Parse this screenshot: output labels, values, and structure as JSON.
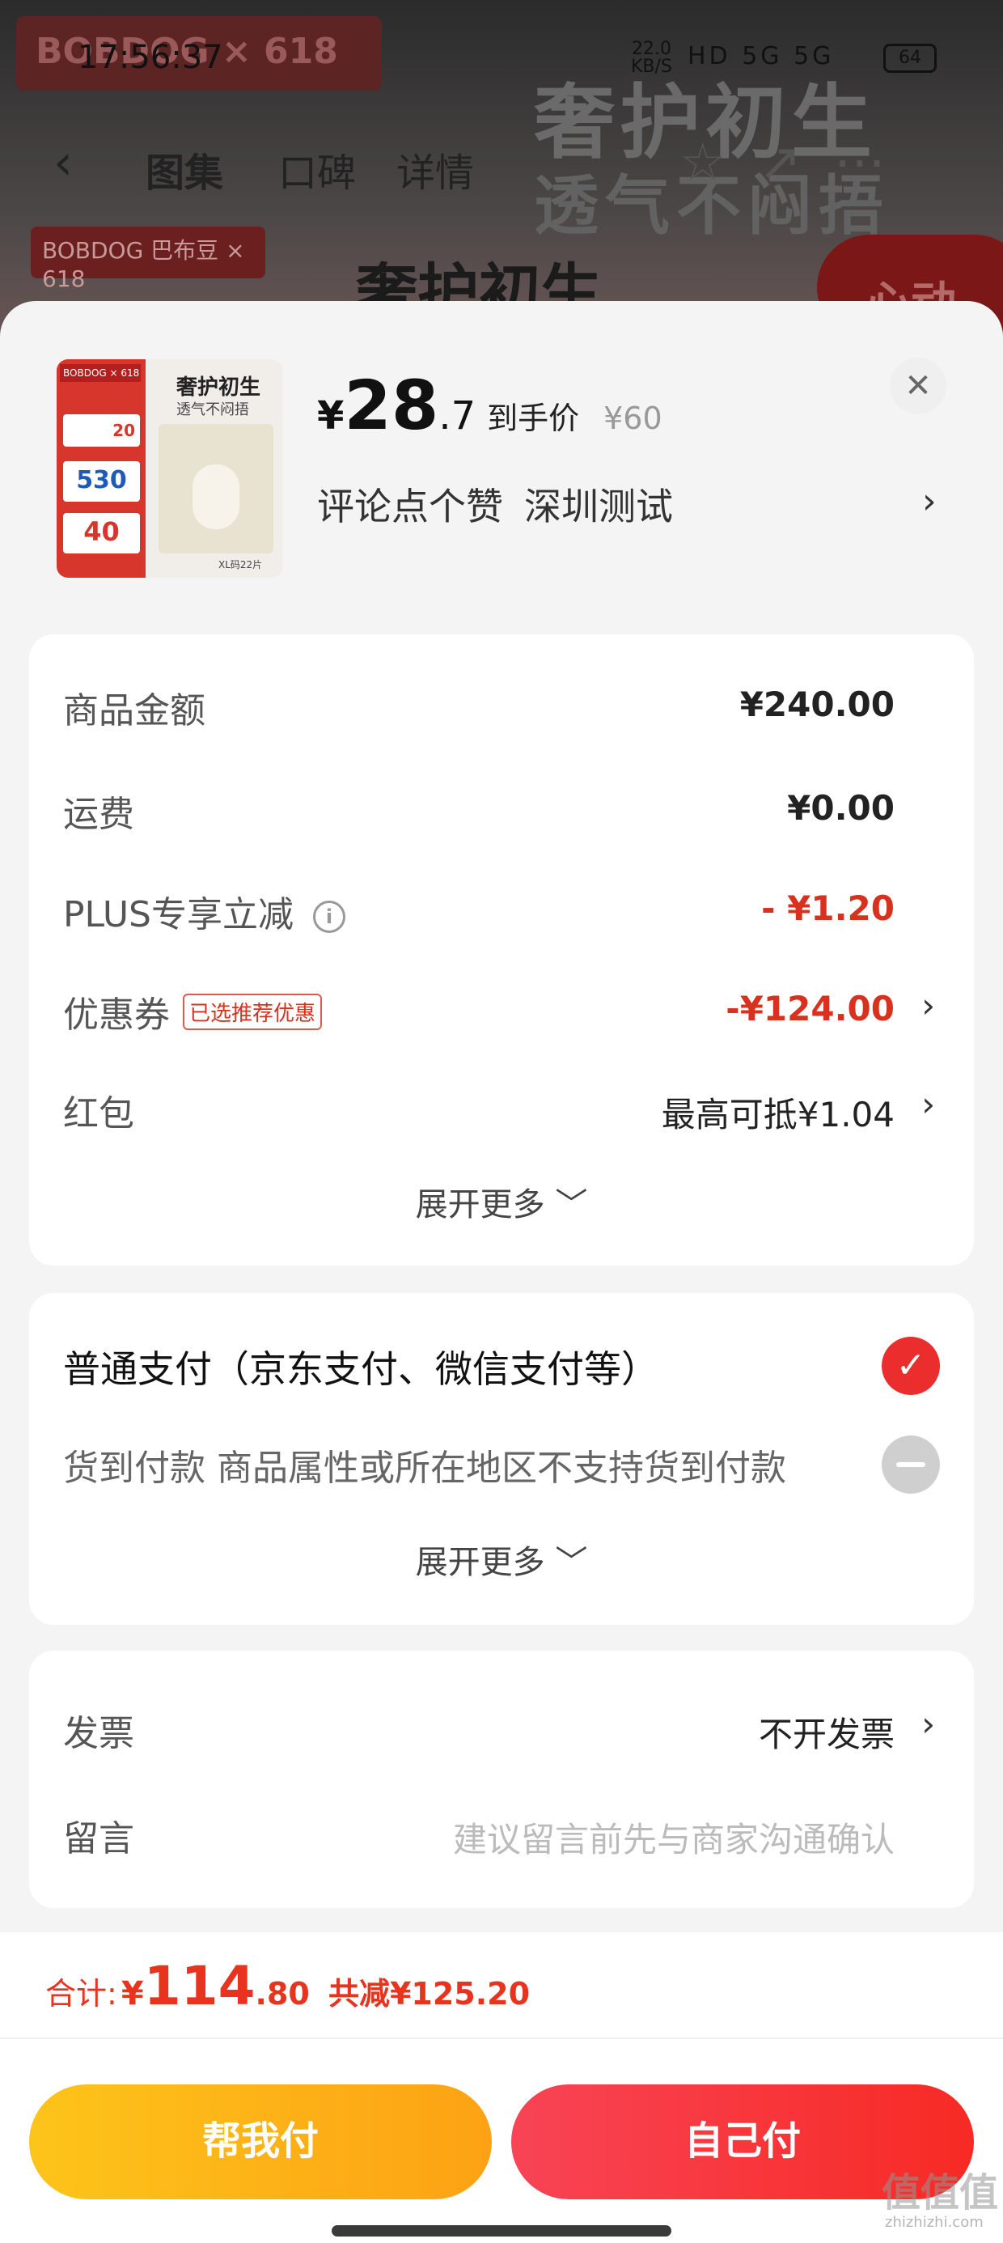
{
  "status_bar": {
    "time": "17:56:37",
    "net_speed": "22.0",
    "net_unit": "KB/S",
    "icons": "HD 5G 5G",
    "battery": "64"
  },
  "background": {
    "badge": "BOBDOG × 618",
    "big_text_1": "奢护初生",
    "big_text_2": "透气不闷捂",
    "nav_tabs": [
      "图集",
      "口碑",
      "详情"
    ],
    "badge2": "BOBDOG 巴布豆 × 618",
    "title": "奢护初生",
    "red_pill": "心动"
  },
  "product": {
    "thumb": {
      "badge": "BOBDOG × 618",
      "title": "奢护初生",
      "subtitle": "透气不闷捂",
      "coupon1": "20",
      "coupon2": "530",
      "coupon3": "40",
      "size": "XL码22片"
    },
    "price_yen": "¥",
    "price_int": "28",
    "price_dec": ".7",
    "price_label": "到手价",
    "original_price": "¥60",
    "spec_1": "评论点个赞",
    "spec_2": "深圳测试"
  },
  "summary": {
    "rows": [
      {
        "label": "商品金额",
        "value": "¥240.00"
      },
      {
        "label": "运费",
        "value": "¥0.00"
      },
      {
        "label": "PLUS专享立减",
        "value": "- ¥1.20"
      },
      {
        "label": "优惠券",
        "tag": "已选推荐优惠",
        "value": "-¥124.00"
      },
      {
        "label": "红包",
        "value": "最高可抵¥1.04"
      }
    ],
    "expand": "展开更多"
  },
  "payment": {
    "options": [
      {
        "label": "普通支付（京东支付、微信支付等）"
      },
      {
        "label": "货到付款 商品属性或所在地区不支持货到付款"
      }
    ],
    "expand": "展开更多"
  },
  "extras": {
    "invoice_label": "发票",
    "invoice_value": "不开发票",
    "message_label": "留言",
    "message_placeholder": "建议留言前先与商家沟通确认"
  },
  "footer": {
    "total_label": "合计:",
    "total_yen": "¥",
    "total_int": "114",
    "total_dec": ".80",
    "saved": "共减¥125.20",
    "help_pay": "帮我付",
    "self_pay": "自己付"
  },
  "watermark": {
    "main": "值值值",
    "sub": "zhizhizhi.com"
  },
  "colors": {
    "accent_red": "#e8331f",
    "yellow": "#fdb617",
    "check_red": "#ec2d2d"
  }
}
